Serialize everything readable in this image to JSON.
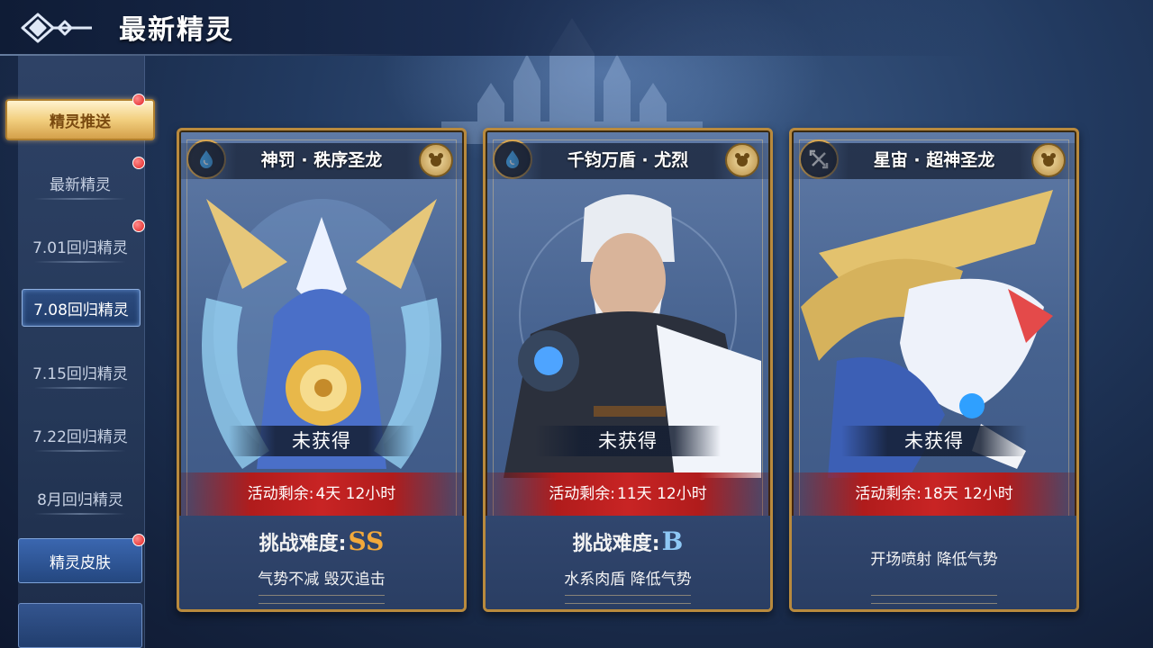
{
  "header": {
    "title": "最新精灵"
  },
  "sidebar": {
    "items": [
      {
        "label": "精灵推送",
        "state": "active",
        "badge": true
      },
      {
        "label": "最新精灵",
        "state": "normal",
        "badge": true
      },
      {
        "label": "7.01回归精灵",
        "state": "normal",
        "badge": true
      },
      {
        "label": "7.08回归精灵",
        "state": "selected",
        "badge": false
      },
      {
        "label": "7.15回归精灵",
        "state": "normal",
        "badge": false
      },
      {
        "label": "7.22回归精灵",
        "state": "normal",
        "badge": false
      },
      {
        "label": "8月回归精灵",
        "state": "normal",
        "badge": false
      },
      {
        "label": "精灵皮肤",
        "state": "skin",
        "badge": true
      }
    ]
  },
  "cards": [
    {
      "name": "神罚 · 秩序圣龙",
      "element_icon": "water-drop-icon",
      "type_icon": "beast-head-icon",
      "status": "未获得",
      "timer_label": "活动剩余:",
      "timer_value": "4天 12小时",
      "difficulty_label": "挑战难度:",
      "difficulty_grade": "SS",
      "grade_color": "#f2a93b",
      "description": "气势不减 毁灭追击"
    },
    {
      "name": "千钧万盾 · 尤烈",
      "element_icon": "water-drop-icon",
      "type_icon": "beast-head-icon",
      "status": "未获得",
      "timer_label": "活动剩余:",
      "timer_value": "11天 12小时",
      "difficulty_label": "挑战难度:",
      "difficulty_grade": "B",
      "grade_color": "#8ec8f5",
      "description": "水系肉盾 降低气势"
    },
    {
      "name": "星宙 · 超神圣龙",
      "element_icon": "cross-swords-icon",
      "type_icon": "beast-head-icon",
      "status": "未获得",
      "timer_label": "活动剩余:",
      "timer_value": "18天 12小时",
      "difficulty_label": "",
      "difficulty_grade": "",
      "grade_color": "#ffffff",
      "description": "开场喷射 降低气势"
    }
  ],
  "colors": {
    "accent_gold": "#b98a3d",
    "timer_red": "#c82424",
    "sidebar_active": "#f2cf7f"
  }
}
